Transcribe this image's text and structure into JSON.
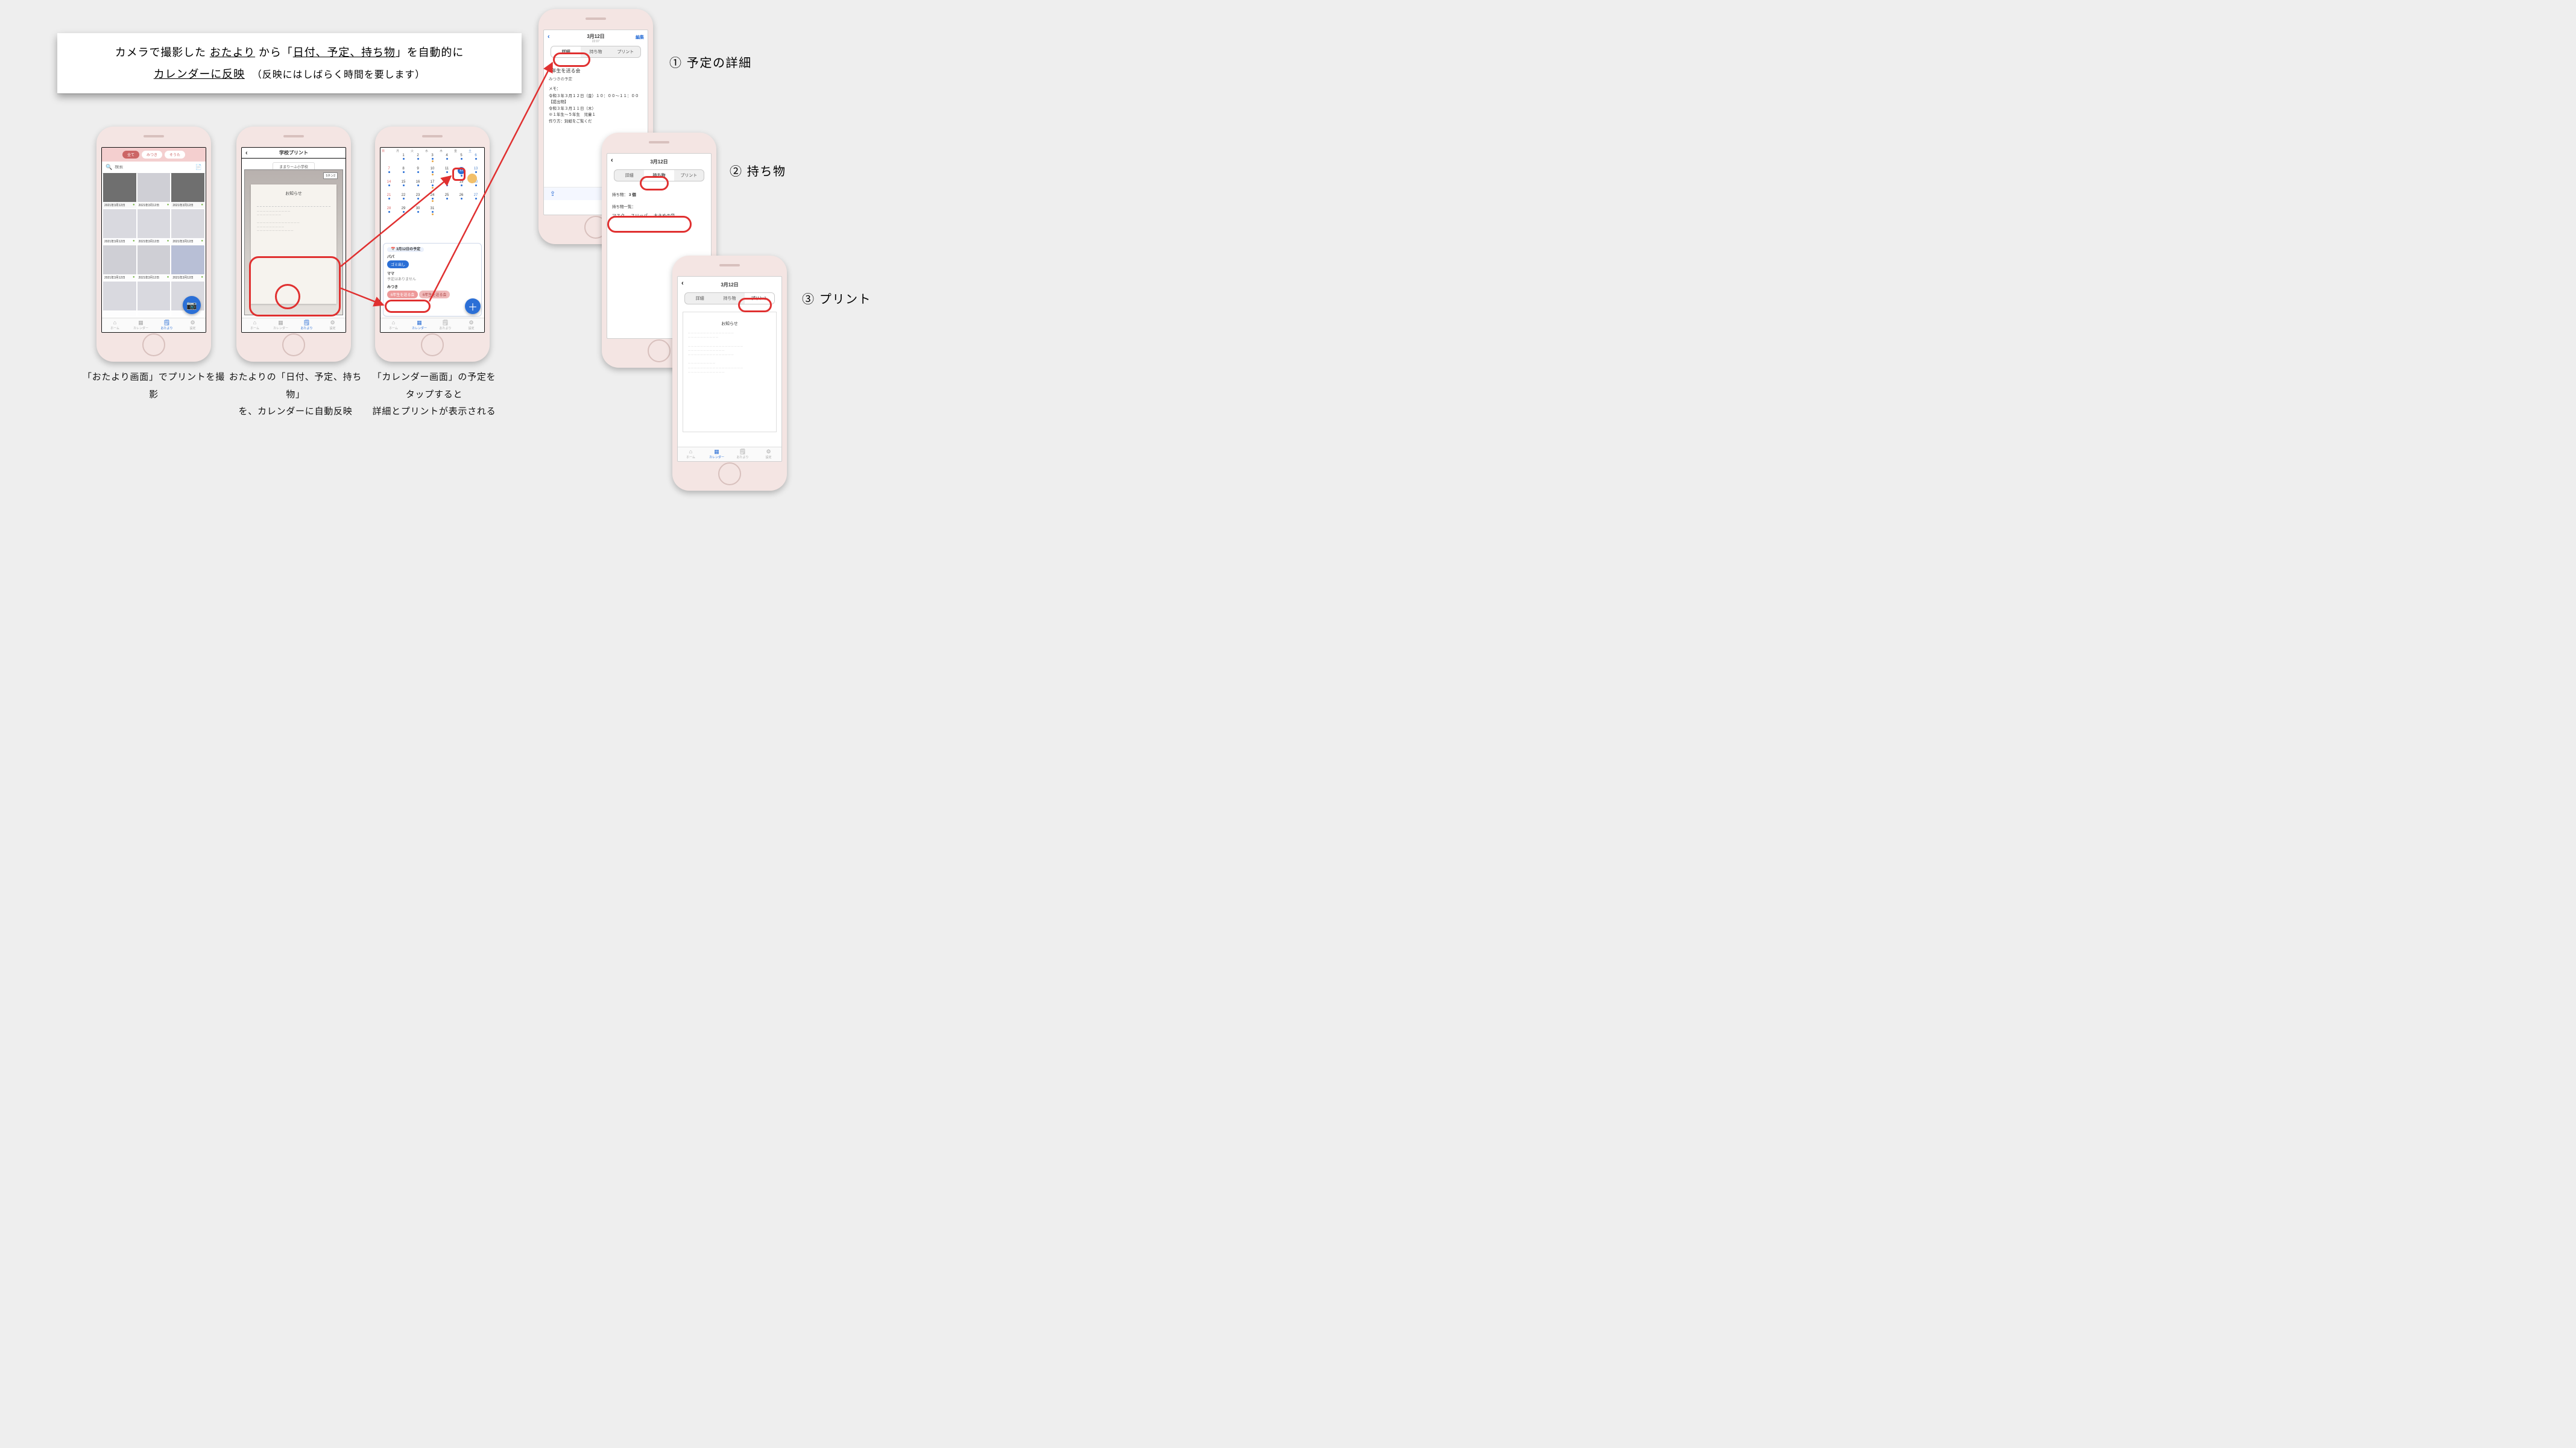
{
  "headline": {
    "line1_pre": "カメラで撮影した ",
    "line1_u1": "おたより",
    "line1_mid": " から「",
    "line1_u2": "日付、予定、持ち物",
    "line1_post": "」を自動的に",
    "line2_u": "カレンダーに反映",
    "line2_small": "（反映にはしばらく時間を要します）"
  },
  "tabs": {
    "home": "ホーム",
    "calendar": "カレンダー",
    "otayori": "おたより",
    "settings": "設定"
  },
  "p1": {
    "chips": [
      "全て",
      "みつき",
      "そうた"
    ],
    "search_placeholder": "検索",
    "date_label": "2021年3月12日",
    "caption": "「おたより画面」でプリントを撮影"
  },
  "p2": {
    "title": "学校プリント",
    "school": "ままりーふ小学校",
    "paper_title": "お知らせ",
    "corner": "5ネン2",
    "caption": "おたよりの「日付、予定、持ち物」\nを、カレンダーに自動反映"
  },
  "p3": {
    "weekdays": [
      "日",
      "月",
      "火",
      "水",
      "木",
      "金",
      "土"
    ],
    "days": [
      "",
      1,
      2,
      3,
      4,
      5,
      6,
      7,
      8,
      9,
      10,
      11,
      12,
      13,
      14,
      15,
      16,
      17,
      18,
      19,
      20,
      21,
      22,
      23,
      24,
      25,
      26,
      27,
      28,
      29,
      30,
      31,
      "",
      "",
      ""
    ],
    "panel_date": "3月12日の予定",
    "papa": "パパ",
    "papa_item": "ゴミ出し",
    "mama": "ママ",
    "mama_none": "予定はありません",
    "mitsuki": "みつき",
    "event1": "6年生を送る会",
    "event2": "6年生を送る会",
    "caption": "「カレンダー画面」の予定を\nタップすると\n詳細とプリントが表示される"
  },
  "p4": {
    "date": "3月12日",
    "time": "22:07",
    "edit": "編集",
    "tabs": [
      "詳細",
      "持ち物",
      "プリント"
    ],
    "title": "6年生を送る会",
    "whose": "みつきの予定",
    "memo_label": "メモ：",
    "memo": "令和３年３月１２日（金）１０：００〜１１：００\n【提出物】\n令和３年３月１１日（木）\n※１年生〜５年生　児童１\n作り方：別紙をご覧くだ",
    "sidelabel": "① 予定の詳細"
  },
  "p5": {
    "date": "3月12日",
    "tabs": [
      "詳細",
      "持ち物",
      "プリント"
    ],
    "count_label": "持ち物：",
    "count": "3 個",
    "list_label": "持ち物一覧：",
    "items": [
      "マスク",
      "スリッパ",
      "大きめの袋"
    ],
    "sidelabel": "② 持ち物"
  },
  "p6": {
    "date": "3月12日",
    "tabs": [
      "詳細",
      "持ち物",
      "プリント"
    ],
    "paper_title": "お知らせ",
    "sidelabel": "③ プリント"
  }
}
